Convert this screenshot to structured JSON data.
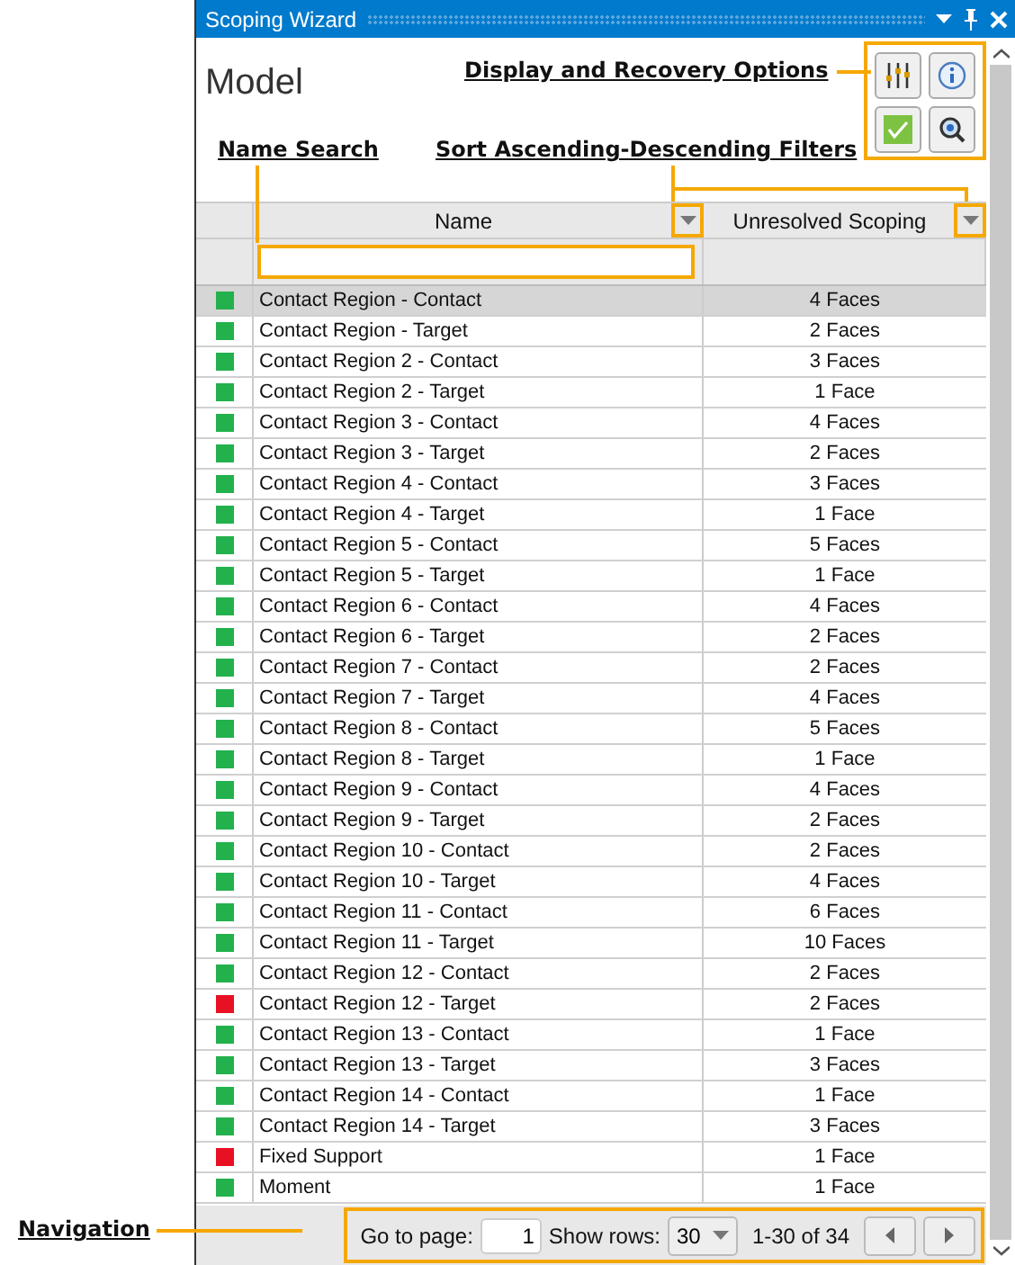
{
  "window": {
    "title": "Scoping Wizard"
  },
  "heading": "Model",
  "toolbar": [
    {
      "kind": "sliders"
    },
    {
      "kind": "info"
    },
    {
      "kind": "check"
    },
    {
      "kind": "zoom"
    }
  ],
  "annotations": [
    {
      "text": "Display and Recovery Options"
    },
    {
      "text": "Name Search"
    },
    {
      "text": "Sort Ascending-Descending Filters"
    },
    {
      "text": "Navigation"
    }
  ],
  "table": {
    "columns": [
      "Name",
      "Unresolved Scoping"
    ],
    "rows": [
      {
        "name": "Contact Region - Contact",
        "scoping": "4 Faces",
        "color": "#22b14c",
        "selected": true
      },
      {
        "name": "Contact Region - Target",
        "scoping": "2 Faces",
        "color": "#22b14c",
        "selected": false
      },
      {
        "name": "Contact Region 2 - Contact",
        "scoping": "3 Faces",
        "color": "#22b14c",
        "selected": false
      },
      {
        "name": "Contact Region 2 - Target",
        "scoping": "1 Face",
        "color": "#22b14c",
        "selected": false
      },
      {
        "name": "Contact Region 3 - Contact",
        "scoping": "4 Faces",
        "color": "#22b14c",
        "selected": false
      },
      {
        "name": "Contact Region 3 - Target",
        "scoping": "2 Faces",
        "color": "#22b14c",
        "selected": false
      },
      {
        "name": "Contact Region 4 - Contact",
        "scoping": "3 Faces",
        "color": "#22b14c",
        "selected": false
      },
      {
        "name": "Contact Region 4 - Target",
        "scoping": "1 Face",
        "color": "#22b14c",
        "selected": false
      },
      {
        "name": "Contact Region 5 - Contact",
        "scoping": "5 Faces",
        "color": "#22b14c",
        "selected": false
      },
      {
        "name": "Contact Region 5 - Target",
        "scoping": "1 Face",
        "color": "#22b14c",
        "selected": false
      },
      {
        "name": "Contact Region 6 - Contact",
        "scoping": "4 Faces",
        "color": "#22b14c",
        "selected": false
      },
      {
        "name": "Contact Region 6 - Target",
        "scoping": "2 Faces",
        "color": "#22b14c",
        "selected": false
      },
      {
        "name": "Contact Region 7 - Contact",
        "scoping": "2 Faces",
        "color": "#22b14c",
        "selected": false
      },
      {
        "name": "Contact Region 7 - Target",
        "scoping": "4 Faces",
        "color": "#22b14c",
        "selected": false
      },
      {
        "name": "Contact Region 8 - Contact",
        "scoping": "5 Faces",
        "color": "#22b14c",
        "selected": false
      },
      {
        "name": "Contact Region 8 - Target",
        "scoping": "1 Face",
        "color": "#22b14c",
        "selected": false
      },
      {
        "name": "Contact Region 9 - Contact",
        "scoping": "4 Faces",
        "color": "#22b14c",
        "selected": false
      },
      {
        "name": "Contact Region 9 - Target",
        "scoping": "2 Faces",
        "color": "#22b14c",
        "selected": false
      },
      {
        "name": "Contact Region 10 - Contact",
        "scoping": "2 Faces",
        "color": "#22b14c",
        "selected": false
      },
      {
        "name": "Contact Region 10 - Target",
        "scoping": "4 Faces",
        "color": "#22b14c",
        "selected": false
      },
      {
        "name": "Contact Region 11 - Contact",
        "scoping": "6 Faces",
        "color": "#22b14c",
        "selected": false
      },
      {
        "name": "Contact Region 11 - Target",
        "scoping": "10 Faces",
        "color": "#22b14c",
        "selected": false
      },
      {
        "name": "Contact Region 12 - Contact",
        "scoping": "2 Faces",
        "color": "#22b14c",
        "selected": false
      },
      {
        "name": "Contact Region 12 - Target",
        "scoping": "2 Faces",
        "color": "#e81123",
        "selected": false
      },
      {
        "name": "Contact Region 13 - Contact",
        "scoping": "1 Face",
        "color": "#22b14c",
        "selected": false
      },
      {
        "name": "Contact Region 13 - Target",
        "scoping": "3 Faces",
        "color": "#22b14c",
        "selected": false
      },
      {
        "name": "Contact Region 14 - Contact",
        "scoping": "1 Face",
        "color": "#22b14c",
        "selected": false
      },
      {
        "name": "Contact Region 14 - Target",
        "scoping": "3 Faces",
        "color": "#22b14c",
        "selected": false
      },
      {
        "name": "Fixed Support",
        "scoping": "1 Face",
        "color": "#e81123",
        "selected": false
      },
      {
        "name": "Moment",
        "scoping": "1 Face",
        "color": "#22b14c",
        "selected": false
      }
    ]
  },
  "footer": {
    "go_to_label": "Go to page:",
    "page": "1",
    "rows_label": "Show rows:",
    "rows_value": "30",
    "range": "1-30 of 34"
  }
}
